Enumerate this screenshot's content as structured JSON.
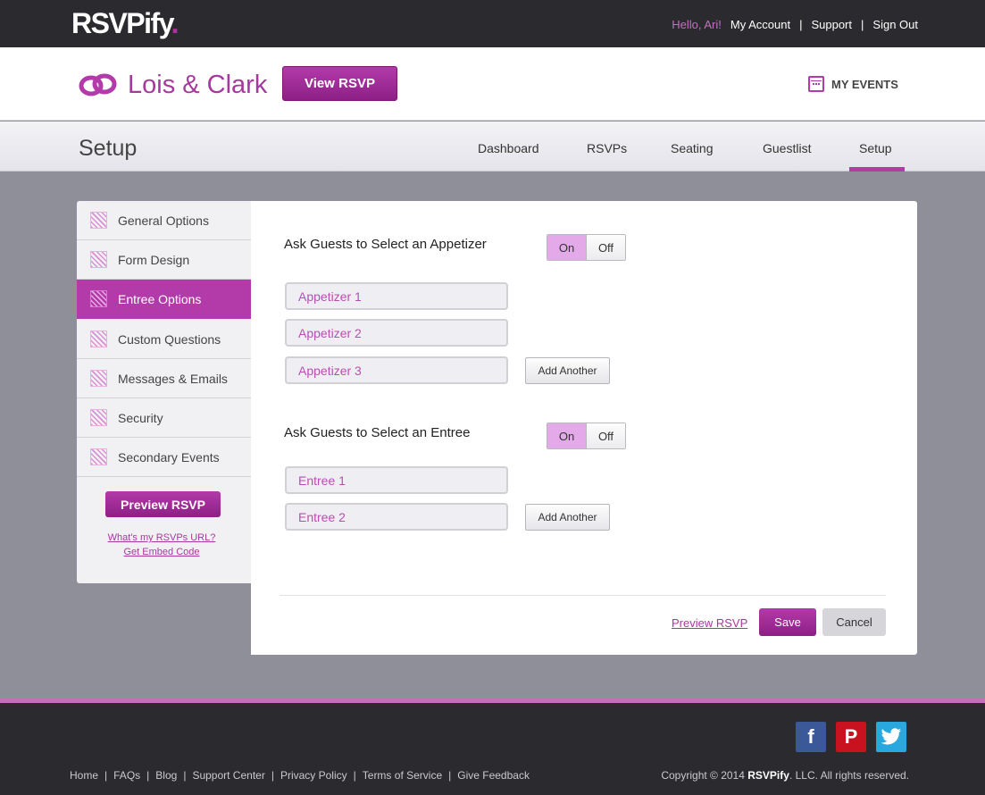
{
  "topbar": {
    "logo": "RSVPify",
    "logo_dot": ".",
    "hello": "Hello, Ari!",
    "my_account": "My Account",
    "support": "Support",
    "sign_out": "Sign Out",
    "separator": "|"
  },
  "event": {
    "title": "Lois & Clark",
    "view_rsvp": "View RSVP",
    "my_events": "MY EVENTS"
  },
  "section": {
    "title": "Setup",
    "tabs": [
      "Dashboard",
      "RSVPs",
      "Seating",
      "Guestlist",
      "Setup"
    ],
    "active_tab": "Setup"
  },
  "sidebar": {
    "items": [
      {
        "label": "General Options"
      },
      {
        "label": "Form Design"
      },
      {
        "label": "Entree Options"
      },
      {
        "label": "Custom Questions"
      },
      {
        "label": "Messages & Emails"
      },
      {
        "label": "Security"
      },
      {
        "label": "Secondary Events"
      }
    ],
    "active_item": "Entree Options",
    "preview_button": "Preview RSVP",
    "url_link": "What's my RSVPs URL?",
    "embed_link": "Get Embed Code"
  },
  "appetizer": {
    "question": "Ask Guests to Select an Appetizer",
    "toggle_on": "On",
    "toggle_off": "Off",
    "fields": [
      "Appetizer 1",
      "Appetizer 2",
      "Appetizer 3"
    ],
    "add_another": "Add Another"
  },
  "entree": {
    "question": "Ask Guests to Select an Entree",
    "toggle_on": "On",
    "toggle_off": "Off",
    "fields": [
      "Entree 1",
      "Entree 2"
    ],
    "add_another": "Add Another"
  },
  "actions": {
    "preview": "Preview RSVP",
    "save": "Save",
    "cancel": "Cancel"
  },
  "footer": {
    "links": [
      "Home",
      "FAQs",
      "Blog",
      "Support Center",
      "Privacy Policy",
      "Terms of Service",
      "Give Feedback"
    ],
    "separator": "|",
    "copyright_prefix": "Copyright © 2014",
    "copyright_brand": "RSVPify",
    "copyright_suffix": ". LLC. All rights reserved.",
    "social": [
      {
        "name": "facebook-icon",
        "glyph": "f",
        "color": "#3b5898"
      },
      {
        "name": "pinterest-icon",
        "glyph": "P",
        "color": "#c8121f"
      },
      {
        "name": "twitter-icon",
        "glyph": "t",
        "color": "#29a8e0"
      }
    ]
  },
  "colors": {
    "accent": "#b23aa9",
    "dark": "#2b2b2f",
    "background": "#8e8f98"
  }
}
